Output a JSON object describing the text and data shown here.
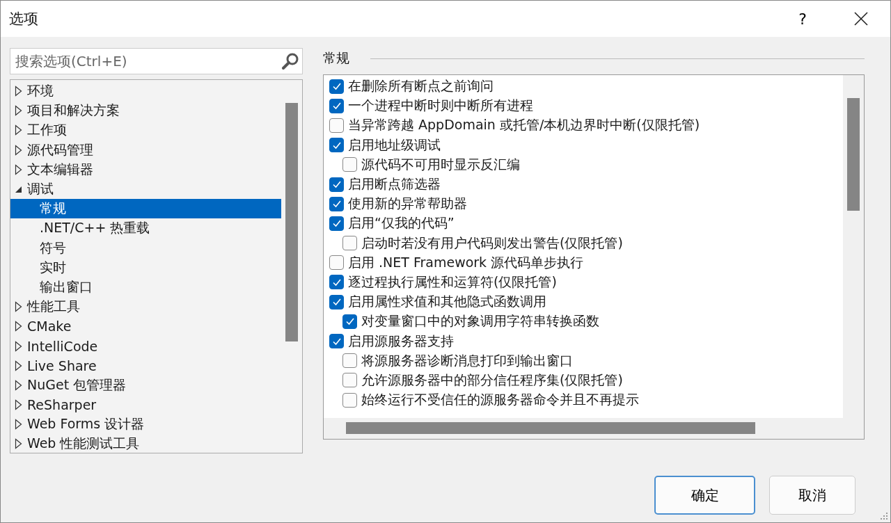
{
  "window": {
    "title": "选项",
    "help": "?"
  },
  "search": {
    "placeholder": "搜索选项(Ctrl+E)"
  },
  "tree": [
    {
      "label": "环境",
      "expanded": false,
      "selected": false
    },
    {
      "label": "项目和解决方案",
      "expanded": false,
      "selected": false
    },
    {
      "label": "工作项",
      "expanded": false,
      "selected": false
    },
    {
      "label": "源代码管理",
      "expanded": false,
      "selected": false
    },
    {
      "label": "文本编辑器",
      "expanded": false,
      "selected": false
    },
    {
      "label": "调试",
      "expanded": true,
      "selected": false,
      "children": [
        {
          "label": "常规",
          "selected": true
        },
        {
          "label": ".NET/C++ 热重载",
          "selected": false
        },
        {
          "label": "符号",
          "selected": false
        },
        {
          "label": "实时",
          "selected": false
        },
        {
          "label": "输出窗口",
          "selected": false
        }
      ]
    },
    {
      "label": "性能工具",
      "expanded": false,
      "selected": false
    },
    {
      "label": "CMake",
      "expanded": false,
      "selected": false
    },
    {
      "label": "IntelliCode",
      "expanded": false,
      "selected": false
    },
    {
      "label": "Live Share",
      "expanded": false,
      "selected": false
    },
    {
      "label": "NuGet 包管理器",
      "expanded": false,
      "selected": false
    },
    {
      "label": "ReSharper",
      "expanded": false,
      "selected": false
    },
    {
      "label": "Web Forms 设计器",
      "expanded": false,
      "selected": false
    },
    {
      "label": "Web 性能测试工具",
      "expanded": false,
      "selected": false
    }
  ],
  "section": {
    "title": "常规"
  },
  "options": [
    {
      "label": "在删除所有断点之前询问",
      "checked": true
    },
    {
      "label": "一个进程中断时则中断所有进程",
      "checked": true
    },
    {
      "label": "当异常跨越 AppDomain 或托管/本机边界时中断(仅限托管)",
      "checked": false
    },
    {
      "label": "启用地址级调试",
      "checked": true,
      "children": [
        {
          "label": "源代码不可用时显示反汇编",
          "checked": false
        }
      ]
    },
    {
      "label": "启用断点筛选器",
      "checked": true
    },
    {
      "label": "使用新的异常帮助器",
      "checked": true
    },
    {
      "label": "启用“仅我的代码”",
      "checked": true,
      "children": [
        {
          "label": "启动时若没有用户代码则发出警告(仅限托管)",
          "checked": false
        }
      ]
    },
    {
      "label": "启用 .NET Framework 源代码单步执行",
      "checked": false
    },
    {
      "label": "逐过程执行属性和运算符(仅限托管)",
      "checked": true
    },
    {
      "label": "启用属性求值和其他隐式函数调用",
      "checked": true,
      "children": [
        {
          "label": "对变量窗口中的对象调用字符串转换函数",
          "checked": true
        }
      ]
    },
    {
      "label": "启用源服务器支持",
      "checked": true,
      "children": [
        {
          "label": "将源服务器诊断消息打印到输出窗口",
          "checked": false
        },
        {
          "label": "允许源服务器中的部分信任程序集(仅限托管)",
          "checked": false
        },
        {
          "label": "始终运行不受信任的源服务器命令并且不再提示",
          "checked": false
        }
      ]
    }
  ],
  "buttons": [
    {
      "label": "确定",
      "default": true
    },
    {
      "label": "取消",
      "default": false
    }
  ]
}
